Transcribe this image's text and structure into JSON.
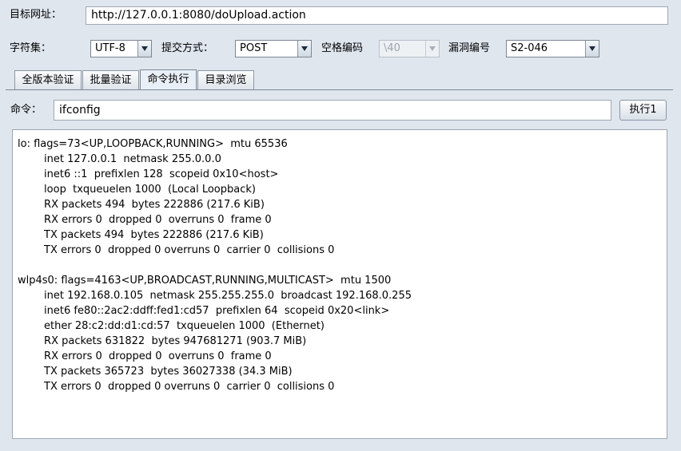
{
  "url_row": {
    "label": "目标网址：",
    "value": "http://127.0.0.1:8080/doUpload.action"
  },
  "options_row": {
    "charset_label": "字符集：",
    "charset_value": "UTF-8",
    "method_label": "提交方式：",
    "method_value": "POST",
    "space_label": "空格编码",
    "space_value": "\\40",
    "vuln_label": "漏洞编号",
    "vuln_value": "S2-046"
  },
  "tabs": [
    {
      "label": "全版本验证"
    },
    {
      "label": "批量验证"
    },
    {
      "label": "命令执行"
    },
    {
      "label": "目录浏览"
    }
  ],
  "command": {
    "label": "命令：",
    "value": "ifconfig",
    "execute_label": "执行1"
  },
  "output_text": "lo: flags=73<UP,LOOPBACK,RUNNING>  mtu 65536\n        inet 127.0.0.1  netmask 255.0.0.0\n        inet6 ::1  prefixlen 128  scopeid 0x10<host>\n        loop  txqueuelen 1000  (Local Loopback)\n        RX packets 494  bytes 222886 (217.6 KiB)\n        RX errors 0  dropped 0  overruns 0  frame 0\n        TX packets 494  bytes 222886 (217.6 KiB)\n        TX errors 0  dropped 0 overruns 0  carrier 0  collisions 0\n\nwlp4s0: flags=4163<UP,BROADCAST,RUNNING,MULTICAST>  mtu 1500\n        inet 192.168.0.105  netmask 255.255.255.0  broadcast 192.168.0.255\n        inet6 fe80::2ac2:ddff:fed1:cd57  prefixlen 64  scopeid 0x20<link>\n        ether 28:c2:dd:d1:cd:57  txqueuelen 1000  (Ethernet)\n        RX packets 631822  bytes 947681271 (903.7 MiB)\n        RX errors 0  dropped 0  overruns 0  frame 0\n        TX packets 365723  bytes 36027338 (34.3 MiB)\n        TX errors 0  dropped 0 overruns 0  carrier 0  collisions 0",
  "colors": {
    "background": "#dfe6ee",
    "border": "#9ea7b3"
  }
}
